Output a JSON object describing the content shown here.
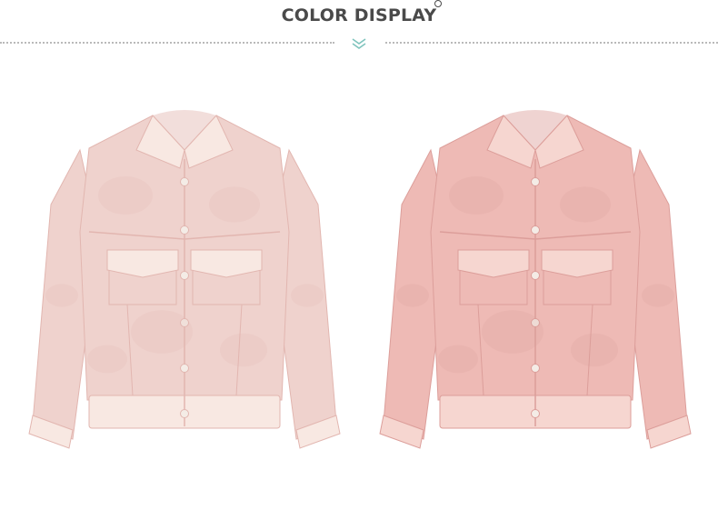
{
  "header": {
    "title": "COLOR DISPLAY"
  },
  "products": [
    {
      "name": "pale-pink-tie-dye-jacket",
      "color": "#efd2cd",
      "shade": "#e2b6b0",
      "light": "#f8e8e2"
    },
    {
      "name": "pink-tie-dye-jacket",
      "color": "#eebab5",
      "shade": "#dc9e9a",
      "light": "#f6d6d0"
    }
  ]
}
